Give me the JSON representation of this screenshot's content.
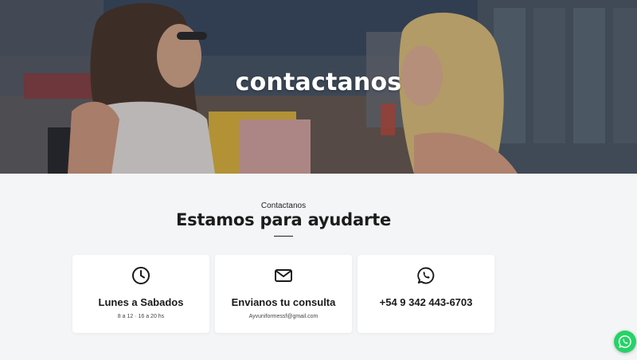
{
  "hero": {
    "title": "contactanos"
  },
  "section": {
    "kicker": "Contactanos",
    "heading": "Estamos para ayudarte"
  },
  "cards": [
    {
      "icon": "clock-icon",
      "title": "Lunes a Sabados",
      "subtitle": "8 a 12 · 16 a 20 hs"
    },
    {
      "icon": "envelope-icon",
      "title": "Envianos tu consulta",
      "subtitle": "Ayvuniformessf@gmail.com"
    },
    {
      "icon": "whatsapp-icon",
      "title": "+54 9 342 443-6703",
      "subtitle": ""
    }
  ],
  "floating": {
    "icon": "whatsapp-icon",
    "color": "#25d366"
  }
}
